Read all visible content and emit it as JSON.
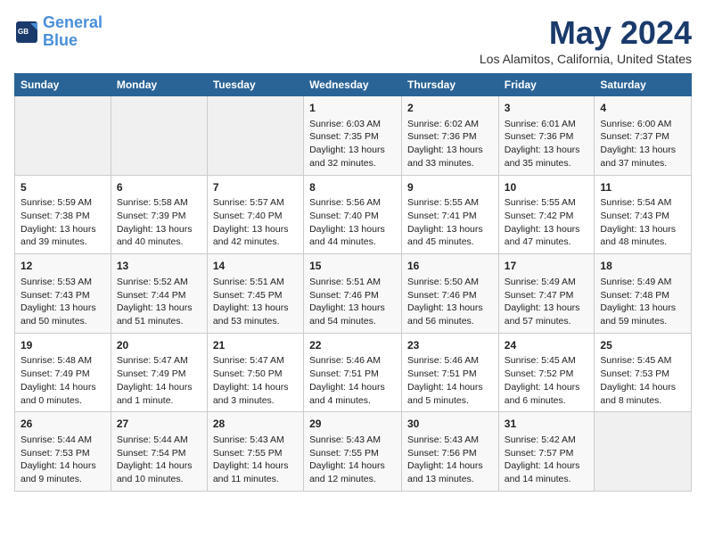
{
  "header": {
    "logo_line1": "General",
    "logo_line2": "Blue",
    "month": "May 2024",
    "location": "Los Alamitos, California, United States"
  },
  "days_of_week": [
    "Sunday",
    "Monday",
    "Tuesday",
    "Wednesday",
    "Thursday",
    "Friday",
    "Saturday"
  ],
  "weeks": [
    [
      {
        "day": "",
        "data": ""
      },
      {
        "day": "",
        "data": ""
      },
      {
        "day": "",
        "data": ""
      },
      {
        "day": "1",
        "data": "Sunrise: 6:03 AM\nSunset: 7:35 PM\nDaylight: 13 hours\nand 32 minutes."
      },
      {
        "day": "2",
        "data": "Sunrise: 6:02 AM\nSunset: 7:36 PM\nDaylight: 13 hours\nand 33 minutes."
      },
      {
        "day": "3",
        "data": "Sunrise: 6:01 AM\nSunset: 7:36 PM\nDaylight: 13 hours\nand 35 minutes."
      },
      {
        "day": "4",
        "data": "Sunrise: 6:00 AM\nSunset: 7:37 PM\nDaylight: 13 hours\nand 37 minutes."
      }
    ],
    [
      {
        "day": "5",
        "data": "Sunrise: 5:59 AM\nSunset: 7:38 PM\nDaylight: 13 hours\nand 39 minutes."
      },
      {
        "day": "6",
        "data": "Sunrise: 5:58 AM\nSunset: 7:39 PM\nDaylight: 13 hours\nand 40 minutes."
      },
      {
        "day": "7",
        "data": "Sunrise: 5:57 AM\nSunset: 7:40 PM\nDaylight: 13 hours\nand 42 minutes."
      },
      {
        "day": "8",
        "data": "Sunrise: 5:56 AM\nSunset: 7:40 PM\nDaylight: 13 hours\nand 44 minutes."
      },
      {
        "day": "9",
        "data": "Sunrise: 5:55 AM\nSunset: 7:41 PM\nDaylight: 13 hours\nand 45 minutes."
      },
      {
        "day": "10",
        "data": "Sunrise: 5:55 AM\nSunset: 7:42 PM\nDaylight: 13 hours\nand 47 minutes."
      },
      {
        "day": "11",
        "data": "Sunrise: 5:54 AM\nSunset: 7:43 PM\nDaylight: 13 hours\nand 48 minutes."
      }
    ],
    [
      {
        "day": "12",
        "data": "Sunrise: 5:53 AM\nSunset: 7:43 PM\nDaylight: 13 hours\nand 50 minutes."
      },
      {
        "day": "13",
        "data": "Sunrise: 5:52 AM\nSunset: 7:44 PM\nDaylight: 13 hours\nand 51 minutes."
      },
      {
        "day": "14",
        "data": "Sunrise: 5:51 AM\nSunset: 7:45 PM\nDaylight: 13 hours\nand 53 minutes."
      },
      {
        "day": "15",
        "data": "Sunrise: 5:51 AM\nSunset: 7:46 PM\nDaylight: 13 hours\nand 54 minutes."
      },
      {
        "day": "16",
        "data": "Sunrise: 5:50 AM\nSunset: 7:46 PM\nDaylight: 13 hours\nand 56 minutes."
      },
      {
        "day": "17",
        "data": "Sunrise: 5:49 AM\nSunset: 7:47 PM\nDaylight: 13 hours\nand 57 minutes."
      },
      {
        "day": "18",
        "data": "Sunrise: 5:49 AM\nSunset: 7:48 PM\nDaylight: 13 hours\nand 59 minutes."
      }
    ],
    [
      {
        "day": "19",
        "data": "Sunrise: 5:48 AM\nSunset: 7:49 PM\nDaylight: 14 hours\nand 0 minutes."
      },
      {
        "day": "20",
        "data": "Sunrise: 5:47 AM\nSunset: 7:49 PM\nDaylight: 14 hours\nand 1 minute."
      },
      {
        "day": "21",
        "data": "Sunrise: 5:47 AM\nSunset: 7:50 PM\nDaylight: 14 hours\nand 3 minutes."
      },
      {
        "day": "22",
        "data": "Sunrise: 5:46 AM\nSunset: 7:51 PM\nDaylight: 14 hours\nand 4 minutes."
      },
      {
        "day": "23",
        "data": "Sunrise: 5:46 AM\nSunset: 7:51 PM\nDaylight: 14 hours\nand 5 minutes."
      },
      {
        "day": "24",
        "data": "Sunrise: 5:45 AM\nSunset: 7:52 PM\nDaylight: 14 hours\nand 6 minutes."
      },
      {
        "day": "25",
        "data": "Sunrise: 5:45 AM\nSunset: 7:53 PM\nDaylight: 14 hours\nand 8 minutes."
      }
    ],
    [
      {
        "day": "26",
        "data": "Sunrise: 5:44 AM\nSunset: 7:53 PM\nDaylight: 14 hours\nand 9 minutes."
      },
      {
        "day": "27",
        "data": "Sunrise: 5:44 AM\nSunset: 7:54 PM\nDaylight: 14 hours\nand 10 minutes."
      },
      {
        "day": "28",
        "data": "Sunrise: 5:43 AM\nSunset: 7:55 PM\nDaylight: 14 hours\nand 11 minutes."
      },
      {
        "day": "29",
        "data": "Sunrise: 5:43 AM\nSunset: 7:55 PM\nDaylight: 14 hours\nand 12 minutes."
      },
      {
        "day": "30",
        "data": "Sunrise: 5:43 AM\nSunset: 7:56 PM\nDaylight: 14 hours\nand 13 minutes."
      },
      {
        "day": "31",
        "data": "Sunrise: 5:42 AM\nSunset: 7:57 PM\nDaylight: 14 hours\nand 14 minutes."
      },
      {
        "day": "",
        "data": ""
      }
    ]
  ]
}
